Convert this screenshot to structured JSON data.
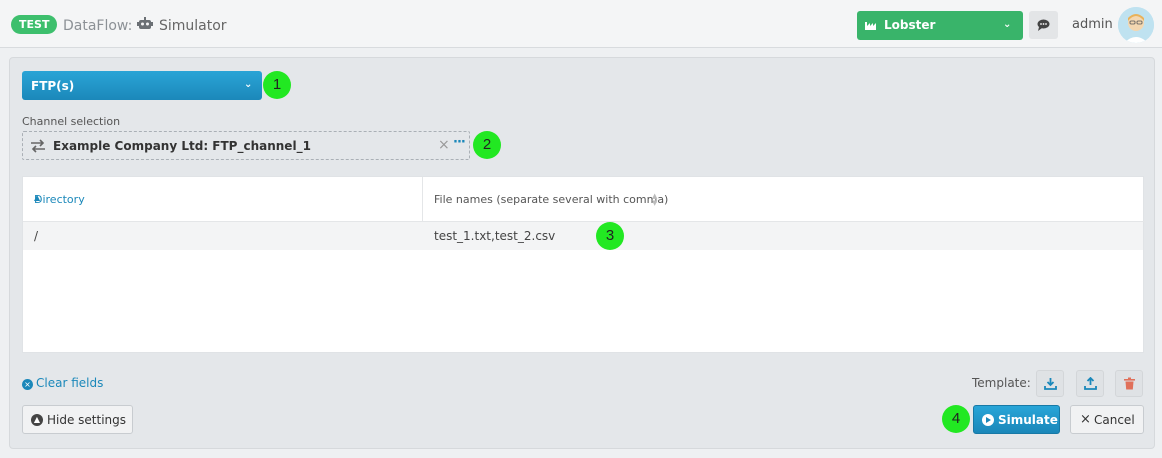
{
  "header": {
    "env_badge": "TEST",
    "brand": "DataFlow:",
    "page_title": "Simulator",
    "tenant": "Lobster",
    "user": "admin"
  },
  "form": {
    "protocol_select": "FTP(s)",
    "channel_label": "Channel selection",
    "channel_value": "Example Company Ltd:  FTP_channel_1"
  },
  "table": {
    "columns": [
      "Directory",
      "File names (separate several with comma)"
    ],
    "rows": [
      {
        "directory": "/",
        "files": "test_1.txt,test_2.csv"
      }
    ]
  },
  "footer": {
    "clear_fields": "Clear fields",
    "template_label": "Template:",
    "hide_settings": "Hide settings",
    "simulate": "Simulate",
    "cancel": "Cancel"
  },
  "markers": [
    "1",
    "2",
    "3",
    "4"
  ],
  "colors": {
    "accent": "#1b88ba",
    "success": "#39b46a",
    "marker": "#22e822",
    "danger": "#e0705a"
  }
}
